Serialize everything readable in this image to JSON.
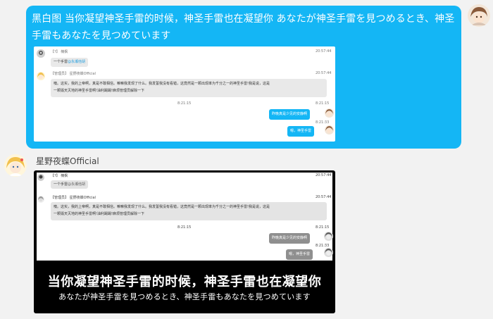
{
  "message_out": {
    "text": "黑白图 当你凝望神圣手雷的时候，神圣手雷也在凝望你 あなたが神圣手雷を見つめるとき、神圣手雷もあなたを見つめています"
  },
  "embedded_light": {
    "msg1_meta": "【?】 楠枫",
    "msg1_time": "20:57:44",
    "msg1_text": "一个手雷",
    "msg1_mention": "@永瀬他胡",
    "msg2_meta": "【管理员】 星野夜蝶Official",
    "msg2_time": "20:57:44",
    "msg2_line1": "噢。这实，我的上帝啊，真是不敢相信。嘛嘛我发现了什么。我发誓我没有看错，这竟然是一颗出现率为千分之一的神圣手雷!我是说，这是",
    "msg2_line2": "一颗毁天灭地的神圣手雷啊!油利踢踢!麻烦管理员解除一下",
    "center_time": "8:21:15",
    "time_right1": "8:21:15",
    "reply1": "昨晚真是少见的安静啊",
    "time_right2": "8:21:33",
    "reply2": "嗯，神圣手雷"
  },
  "sender": {
    "name": "星野夜蝶Official"
  },
  "embedded_dark": {
    "msg1_meta": "【?】 楠枫",
    "msg1_time": "20:57:44",
    "msg1_text": "一个手雷",
    "msg1_mention": "@永瀬他胡",
    "msg2_meta": "【管理员】 星野夜蝶Official",
    "msg2_time": "20:57:44",
    "msg2_line1": "噢。这实，我的上帝啊，真是不敢相信。嘛嘛我发现了什么。我发誓我没有看错，这竟然是一颗出现率为千分之一的神圣手雷!我是说，这是",
    "msg2_line2": "一颗毁天灭地的神圣手雷啊!油利踢踢!麻烦管理员解除一下",
    "center_time": "8:21:15",
    "time_right1": "8:21:15",
    "reply1": "昨晚真是少见的安静啊",
    "time_right2": "8:21:33",
    "reply2": "嗯，神圣手雷",
    "caption_line1": "当你凝望神圣手雷的时候，神圣手雷也在凝望你",
    "caption_line2": "あなたが神圣手雷を見つめるとき、神圣手雷もあなたを見つめています"
  },
  "colors": {
    "accent": "#14b6f5",
    "background": "#f2f2f2"
  }
}
